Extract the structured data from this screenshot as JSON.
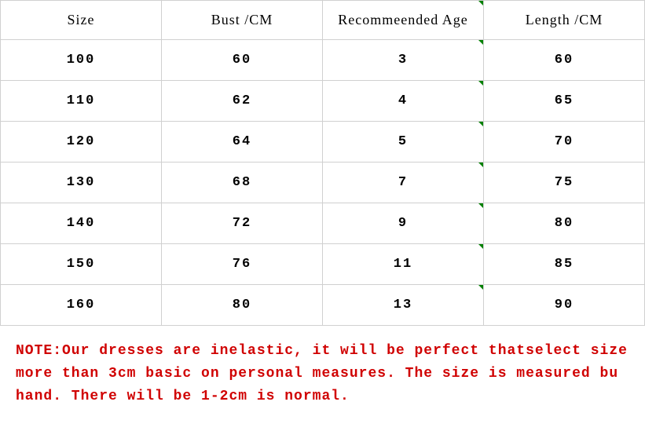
{
  "chart_data": {
    "type": "table",
    "headers": [
      "Size",
      "Bust /CM",
      "Recommeended Age",
      "Length /CM"
    ],
    "rows": [
      [
        "100",
        "60",
        "3",
        "60"
      ],
      [
        "110",
        "62",
        "4",
        "65"
      ],
      [
        "120",
        "64",
        "5",
        "70"
      ],
      [
        "130",
        "68",
        "7",
        "75"
      ],
      [
        "140",
        "72",
        "9",
        "80"
      ],
      [
        "150",
        "76",
        "11",
        "85"
      ],
      [
        "160",
        "80",
        "13",
        "90"
      ]
    ]
  },
  "note_text": "NOTE:Our dresses are inelastic, it will be perfect thatselect size more than 3cm basic on personal measures. The size is measured bu hand. There will be 1-2cm is normal."
}
